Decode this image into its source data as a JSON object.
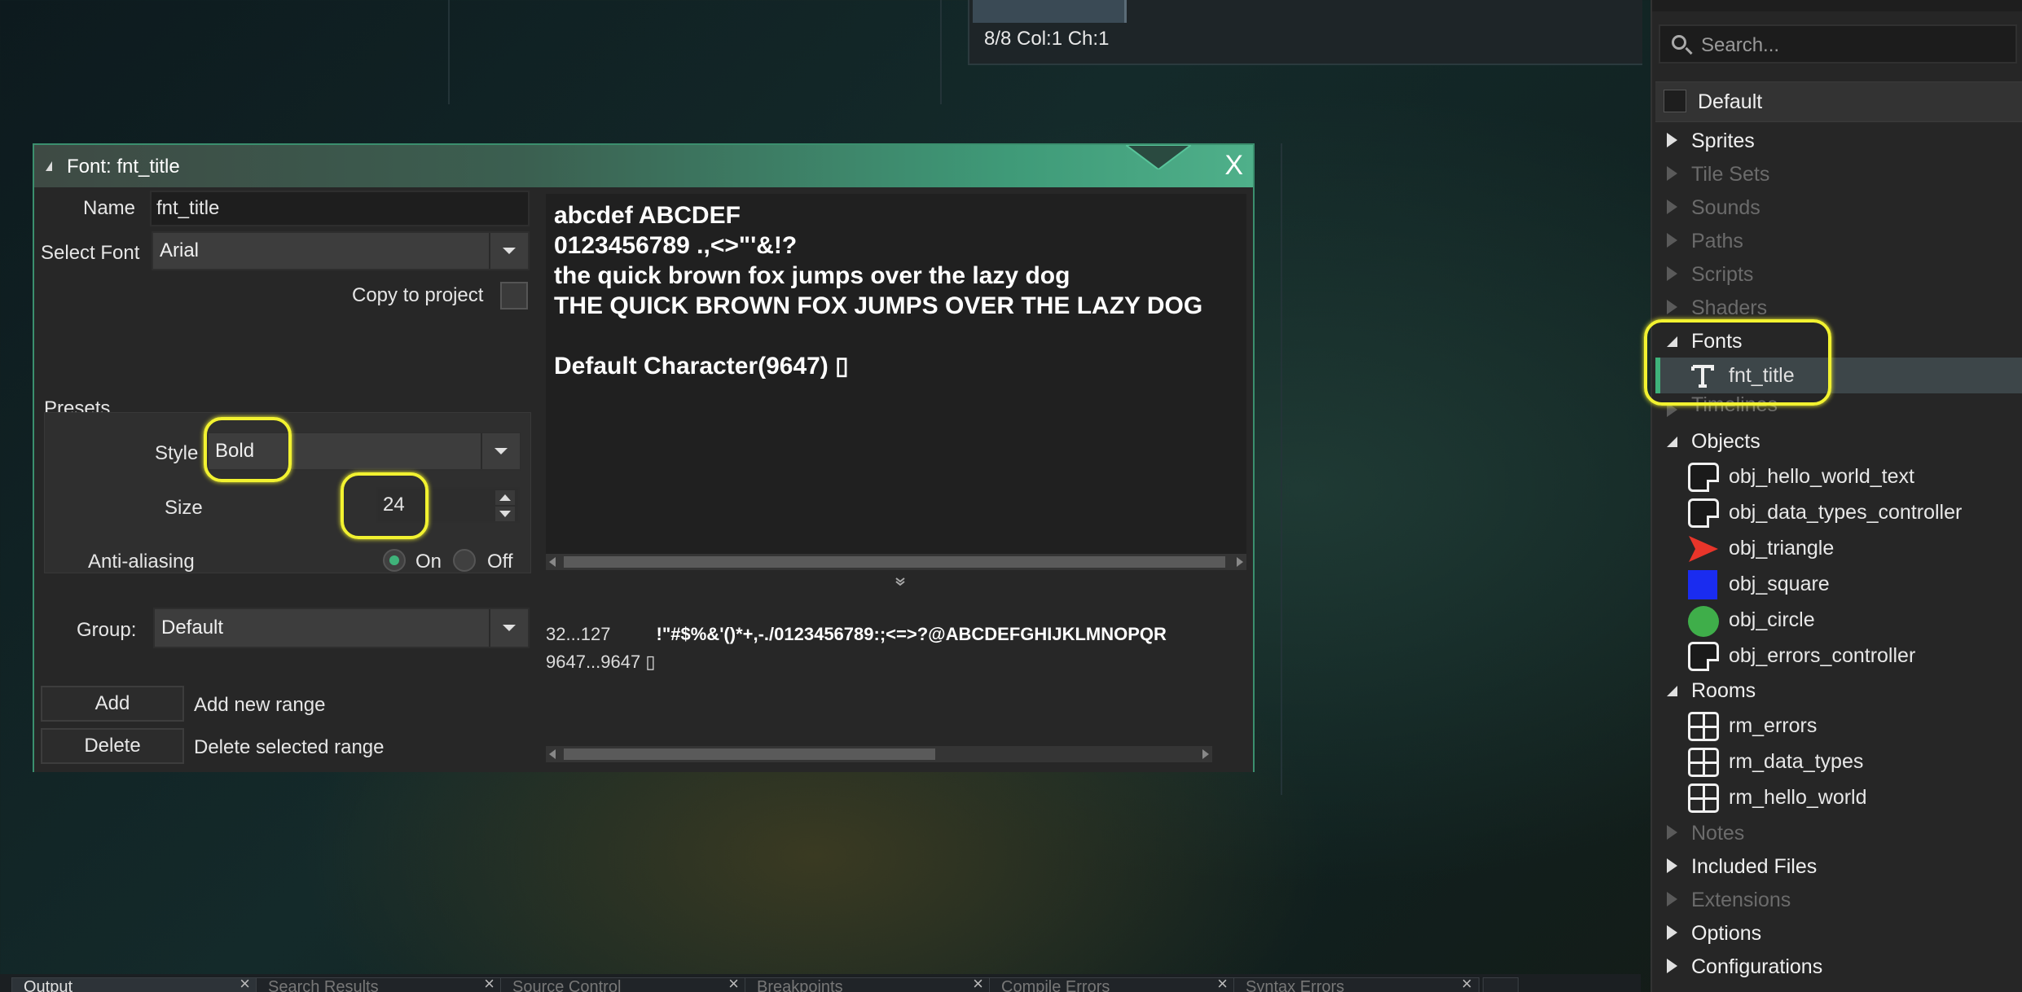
{
  "editor": {
    "status": "8/8 Col:1 Ch:1"
  },
  "font_window": {
    "title": "Font: fnt_title",
    "close_glyph": "X",
    "name_label": "Name",
    "name_value": "fnt_title",
    "select_font_label": "Select Font",
    "select_font_value": "Arial",
    "copy_to_project_label": "Copy to project",
    "presets_label": "Presets",
    "style_label": "Style",
    "style_value": "Bold",
    "size_label": "Size",
    "size_value": "24",
    "antialias_label": "Anti-aliasing",
    "antialias_on": "On",
    "antialias_off": "Off",
    "group_label": "Group:",
    "group_value": "Default",
    "add_button": "Add",
    "add_desc": "Add new range",
    "delete_button": "Delete",
    "delete_desc": "Delete selected range",
    "preview_lines": [
      "abcdef ABCDEF",
      "0123456789 .,<>\"'&!?",
      "the quick brown fox jumps over the lazy dog",
      "THE QUICK BROWN FOX JUMPS OVER THE LAZY DOG",
      "Default Character(9647) ▯"
    ],
    "ranges": [
      {
        "range": "32...127",
        "chars": "!\"#$%&'()*+,-./0123456789:;<=>?@ABCDEFGHIJKLMNOPQR"
      },
      {
        "range": "9647...9647 ▯",
        "chars": ""
      }
    ]
  },
  "bottom_tabs": [
    "Output",
    "Search Results",
    "Source Control",
    "Breakpoints",
    "Compile Errors",
    "Syntax Errors"
  ],
  "resources": {
    "search_placeholder": "Search...",
    "config": "Default",
    "groups": [
      {
        "label": "Sprites",
        "state": "closed",
        "dim": false
      },
      {
        "label": "Tile Sets",
        "state": "closed",
        "dim": true
      },
      {
        "label": "Sounds",
        "state": "closed",
        "dim": true
      },
      {
        "label": "Paths",
        "state": "closed",
        "dim": true
      },
      {
        "label": "Scripts",
        "state": "closed",
        "dim": true
      },
      {
        "label": "Shaders",
        "state": "closed",
        "dim": true
      },
      {
        "label": "Fonts",
        "state": "open",
        "dim": false
      },
      {
        "label": "Timelines",
        "state": "closed",
        "dim": true
      },
      {
        "label": "Objects",
        "state": "open",
        "dim": false
      },
      {
        "label": "Rooms",
        "state": "open",
        "dim": false
      },
      {
        "label": "Notes",
        "state": "closed",
        "dim": true
      },
      {
        "label": "Included Files",
        "state": "closed",
        "dim": false
      },
      {
        "label": "Extensions",
        "state": "closed",
        "dim": true
      },
      {
        "label": "Options",
        "state": "closed",
        "dim": false
      },
      {
        "label": "Configurations",
        "state": "closed",
        "dim": false
      }
    ],
    "fonts": [
      "fnt_title"
    ],
    "objects": [
      "obj_hello_world_text",
      "obj_data_types_controller",
      "obj_triangle",
      "obj_square",
      "obj_circle",
      "obj_errors_controller"
    ],
    "rooms": [
      "rm_errors",
      "rm_data_types",
      "rm_hello_world"
    ]
  },
  "colors": {
    "accent": "#3fb37a",
    "highlight": "#f2f230",
    "triangle": "#e8352a",
    "square": "#1a2cf0",
    "circle": "#3fae4a"
  }
}
